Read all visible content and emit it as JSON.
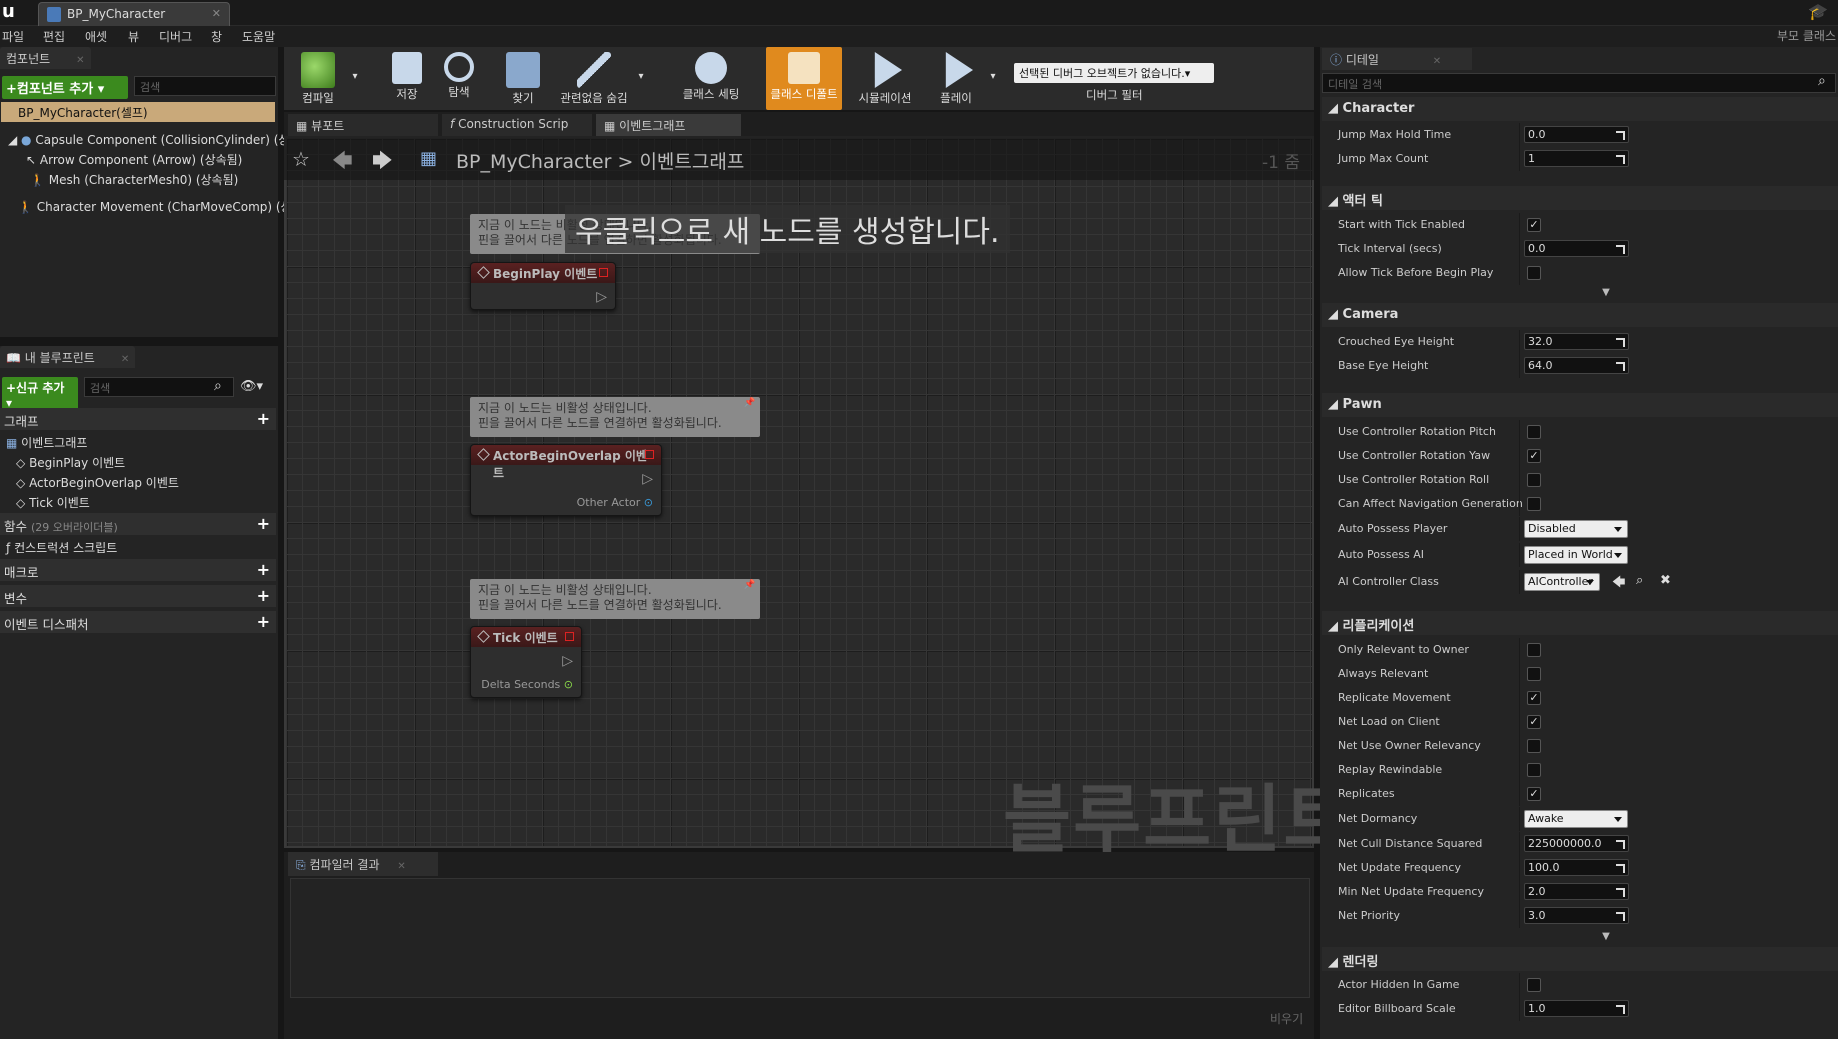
{
  "app": {
    "document_tab": "BP_MyCharacter",
    "right_label": "부모 클래스"
  },
  "menu": [
    "파일",
    "편집",
    "애셋",
    "뷰",
    "디버그",
    "창",
    "도움말"
  ],
  "components": {
    "tab": "컴포넌트",
    "add_button": "+컴포넌트 추가 ▾",
    "search_placeholder": "검색",
    "root": "BP_MyCharacter(셀프)",
    "items": [
      "Capsule Component (CollisionCylinder) (상속",
      "Arrow Component (Arrow) (상속됨)",
      "Mesh (CharacterMesh0) (상속됨)",
      "Character Movement (CharMoveComp) (상속"
    ]
  },
  "my_blueprint": {
    "tab": "내 블루프린트",
    "add_button": "+신규 추가 ▾",
    "search_placeholder": "검색",
    "graphs_header": "그래프",
    "event_graph": "이벤트그래프",
    "events": [
      "BeginPlay 이벤트",
      "ActorBeginOverlap 이벤트",
      "Tick 이벤트"
    ],
    "functions_header": "함수",
    "functions_count": "(29 오버라이더블)",
    "construction_script": "컨스트럭션 스크립트",
    "macros": "매크로",
    "variables": "변수",
    "dispatchers": "이벤트 디스패처"
  },
  "toolbar": {
    "compile": "컴파일",
    "save": "저장",
    "browse": "탐색",
    "find": "찾기",
    "hide_unrelated": "관련없음 숨김",
    "class_settings": "클래스 세팅",
    "class_defaults": "클래스 디폴트",
    "simulation": "시뮬레이션",
    "play": "플레이",
    "debug_object": "선택된 디버그 오브젝트가 없습니다.▾",
    "debug_filter": "디버그 필터"
  },
  "graph_tabs": [
    "뷰포트",
    "Construction Scrip",
    "이벤트그래프"
  ],
  "graph": {
    "crumb_bp": "BP_MyCharacter",
    "crumb_sep": ">",
    "crumb_graph": "이벤트그래프",
    "zoom": "-1 줌",
    "hint": "우클릭으로 새 노드를 생성합니다.",
    "watermark": "블루프린트",
    "comment_line1": "지금 이 노드는 비활성 상태입니다.",
    "comment_line2": "핀을 끌어서 다른 노드를 연결하면 활성화됩니다.",
    "nodes": [
      {
        "title": "BeginPlay 이벤트",
        "pin": ""
      },
      {
        "title": "ActorBeginOverlap 이벤트",
        "pin": "Other Actor"
      },
      {
        "title": "Tick 이벤트",
        "pin": "Delta Seconds"
      }
    ]
  },
  "compiler": {
    "tab": "컴파일러 결과",
    "clear": "비우기"
  },
  "details": {
    "tab": "디테일",
    "search_placeholder": "디테일 검색",
    "character": {
      "header": "Character",
      "jump_max_hold_time_label": "Jump Max Hold Time",
      "jump_max_hold_time": "0.0",
      "jump_max_count_label": "Jump Max Count",
      "jump_max_count": "1"
    },
    "actor_tick": {
      "header": "액터 틱",
      "start_with_tick_label": "Start with Tick Enabled",
      "tick_interval_label": "Tick Interval (secs)",
      "tick_interval": "0.0",
      "allow_tick_label": "Allow Tick Before Begin Play"
    },
    "camera": {
      "header": "Camera",
      "crouched_eye_label": "Crouched Eye Height",
      "crouched_eye": "32.0",
      "base_eye_label": "Base Eye Height",
      "base_eye": "64.0"
    },
    "pawn": {
      "header": "Pawn",
      "pitch_label": "Use Controller Rotation Pitch",
      "yaw_label": "Use Controller Rotation Yaw",
      "roll_label": "Use Controller Rotation Roll",
      "nav_label": "Can Affect Navigation Generation",
      "auto_player_label": "Auto Possess Player",
      "auto_player": "Disabled",
      "auto_ai_label": "Auto Possess AI",
      "auto_ai": "Placed in World",
      "ai_class_label": "AI Controller Class",
      "ai_class": "AIController"
    },
    "replication": {
      "header": "리플리케이션",
      "only_relevant_label": "Only Relevant to Owner",
      "always_relevant_label": "Always Relevant",
      "replicate_movement_label": "Replicate Movement",
      "net_load_label": "Net Load on Client",
      "net_owner_label": "Net Use Owner Relevancy",
      "replay_label": "Replay Rewindable",
      "replicates_label": "Replicates",
      "dormancy_label": "Net Dormancy",
      "dormancy": "Awake",
      "cull_label": "Net Cull Distance Squared",
      "cull": "225000000.0",
      "freq_label": "Net Update Frequency",
      "freq": "100.0",
      "min_freq_label": "Min Net Update Frequency",
      "min_freq": "2.0",
      "priority_label": "Net Priority",
      "priority": "3.0"
    },
    "rendering": {
      "header": "렌더링",
      "hidden_label": "Actor Hidden In Game",
      "billboard_label": "Editor Billboard Scale",
      "billboard": "1.0"
    }
  },
  "colors": {
    "accent_orange": "#e08a1e",
    "add_green": "#3b8a1e",
    "node_header_red": "#5a2121"
  }
}
